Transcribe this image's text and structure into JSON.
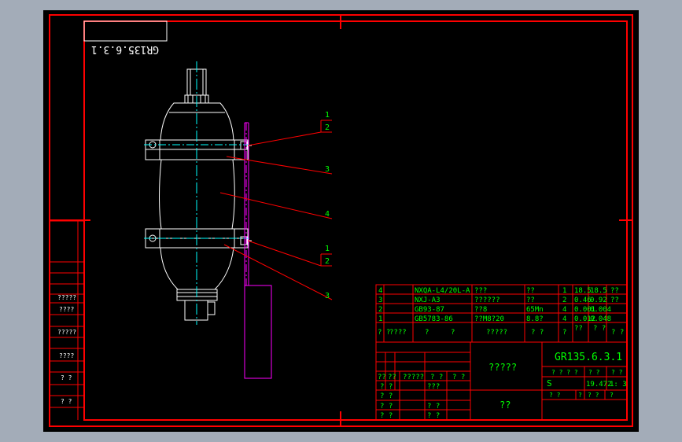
{
  "drawing": {
    "title_box_text": "GR135.6.3.1",
    "balloons": {
      "top": [
        "1",
        "2",
        "3",
        "4"
      ],
      "bottom": [
        "1",
        "2",
        "3"
      ]
    }
  },
  "left_strip": {
    "labels": [
      "?????",
      "????",
      "?????",
      "????",
      "? ?",
      "? ?"
    ]
  },
  "bom": {
    "rows": [
      {
        "idx": "4",
        "code": "NXQA-L4/20L-A",
        "name": "???",
        "qty": "??",
        "n": "1",
        "w1": "18.5",
        "w2": "18.5",
        "rem": "??"
      },
      {
        "idx": "3",
        "code": "NXJ-A3",
        "name": "??????",
        "qty": "??",
        "n": "2",
        "w1": "0.46",
        "w2": "0.92",
        "rem": "??"
      },
      {
        "idx": "2",
        "code": "GB93-87",
        "name": "??8",
        "qty": "65Mn",
        "n": "4",
        "w1": "0.001",
        "w2": "0.004",
        "rem": ""
      },
      {
        "idx": "1",
        "code": "GB5783-86",
        "name": "??M8?20",
        "qty": "8.8?",
        "n": "4",
        "w1": "0.012",
        "w2": "0.048",
        "rem": ""
      }
    ],
    "header": {
      "c1": "? ?",
      "c2": "????",
      "c3": "?",
      "c4": "?",
      "c5": "?????",
      "c6": "? ?",
      "c7": "?",
      "c8": "??",
      "c9": "? ?",
      "c10": "? ?"
    }
  },
  "title_block": {
    "drawing_no": "GR135.6.3.1",
    "name": "?????",
    "company": "??",
    "row_a": {
      "a": "??",
      "b": "??",
      "c": "?????",
      "d": "? ?",
      "e": "? ?"
    },
    "sign_labels": [
      "? ?",
      "? ?",
      "? ?",
      "? ?"
    ],
    "sign_labels2": [
      "???",
      "? ?",
      "? ?"
    ],
    "stage_header": "? ? ? ?",
    "weight_header": "? ?",
    "scale_header": "? ?",
    "stage": "S",
    "weight": "19.472",
    "scale": "1: 3",
    "sheet_a": "? ?",
    "sheet_b": "?",
    "sheet_c": "? ?",
    "sheet_d": "?"
  }
}
